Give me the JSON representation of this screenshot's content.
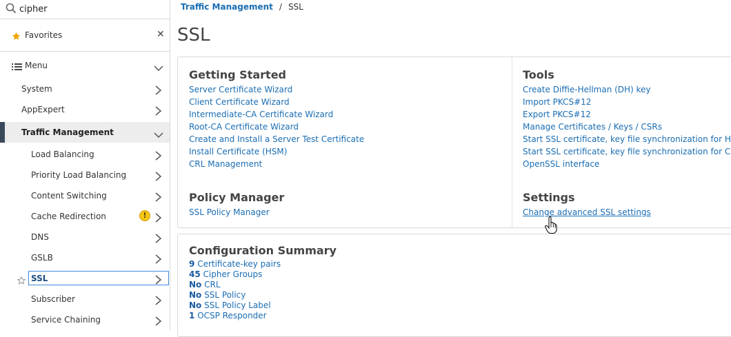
{
  "sidebar": {
    "search": {
      "value": "cipher",
      "icon": "search-icon"
    },
    "favorites": {
      "label": "Favorites"
    },
    "menu_label": "Menu",
    "items": [
      {
        "label": "System",
        "level": 1
      },
      {
        "label": "AppExpert",
        "level": 1
      },
      {
        "label": "Traffic Management",
        "level": 1,
        "state": "expanded"
      },
      {
        "label": "Load Balancing",
        "level": 2
      },
      {
        "label": "Priority Load Balancing",
        "level": 2
      },
      {
        "label": "Content Switching",
        "level": 2
      },
      {
        "label": "Cache Redirection",
        "level": 2,
        "badge": "!"
      },
      {
        "label": "DNS",
        "level": 2
      },
      {
        "label": "GSLB",
        "level": 2
      },
      {
        "label": "SSL",
        "level": 2,
        "state": "selected"
      },
      {
        "label": "Subscriber",
        "level": 2
      },
      {
        "label": "Service Chaining",
        "level": 2
      }
    ]
  },
  "breadcrumb": {
    "parent": "Traffic Management",
    "separator": "/",
    "current": "SSL"
  },
  "page_title": "SSL",
  "getting_started": {
    "title": "Getting Started",
    "links": [
      "Server Certificate Wizard",
      "Client Certificate Wizard",
      "Intermediate-CA Certificate Wizard",
      "Root-CA Certificate Wizard",
      "Create and Install a Server Test Certificate",
      "Install Certificate (HSM)",
      "CRL Management"
    ]
  },
  "tools": {
    "title": "Tools",
    "links": [
      "Create Diffie-Hellman (DH) key",
      "Import PKCS#12",
      "Export PKCS#12",
      "Manage Certificates / Keys / CSRs",
      "Start SSL certificate, key file synchronization for HA",
      "Start SSL certificate, key file synchronization for Cluster",
      "OpenSSL interface"
    ]
  },
  "policy_manager": {
    "title": "Policy Manager",
    "links": [
      "SSL Policy Manager"
    ]
  },
  "settings": {
    "title": "Settings",
    "links": [
      "Change advanced SSL settings"
    ]
  },
  "configuration_summary": {
    "title": "Configuration Summary",
    "items": [
      {
        "value": "9",
        "label": "Certificate-key pairs"
      },
      {
        "value": "45",
        "label": "Cipher Groups"
      },
      {
        "value": "No",
        "label": "CRL"
      },
      {
        "value": "No",
        "label": "SSL Policy"
      },
      {
        "value": "No",
        "label": "SSL Policy Label"
      },
      {
        "value": "1",
        "label": "OCSP Responder"
      }
    ]
  },
  "colors": {
    "link": "#1a6db3",
    "active_bar": "#3a4a5a",
    "selected_border": "#3b8ad9",
    "warning": "#f5c518"
  }
}
